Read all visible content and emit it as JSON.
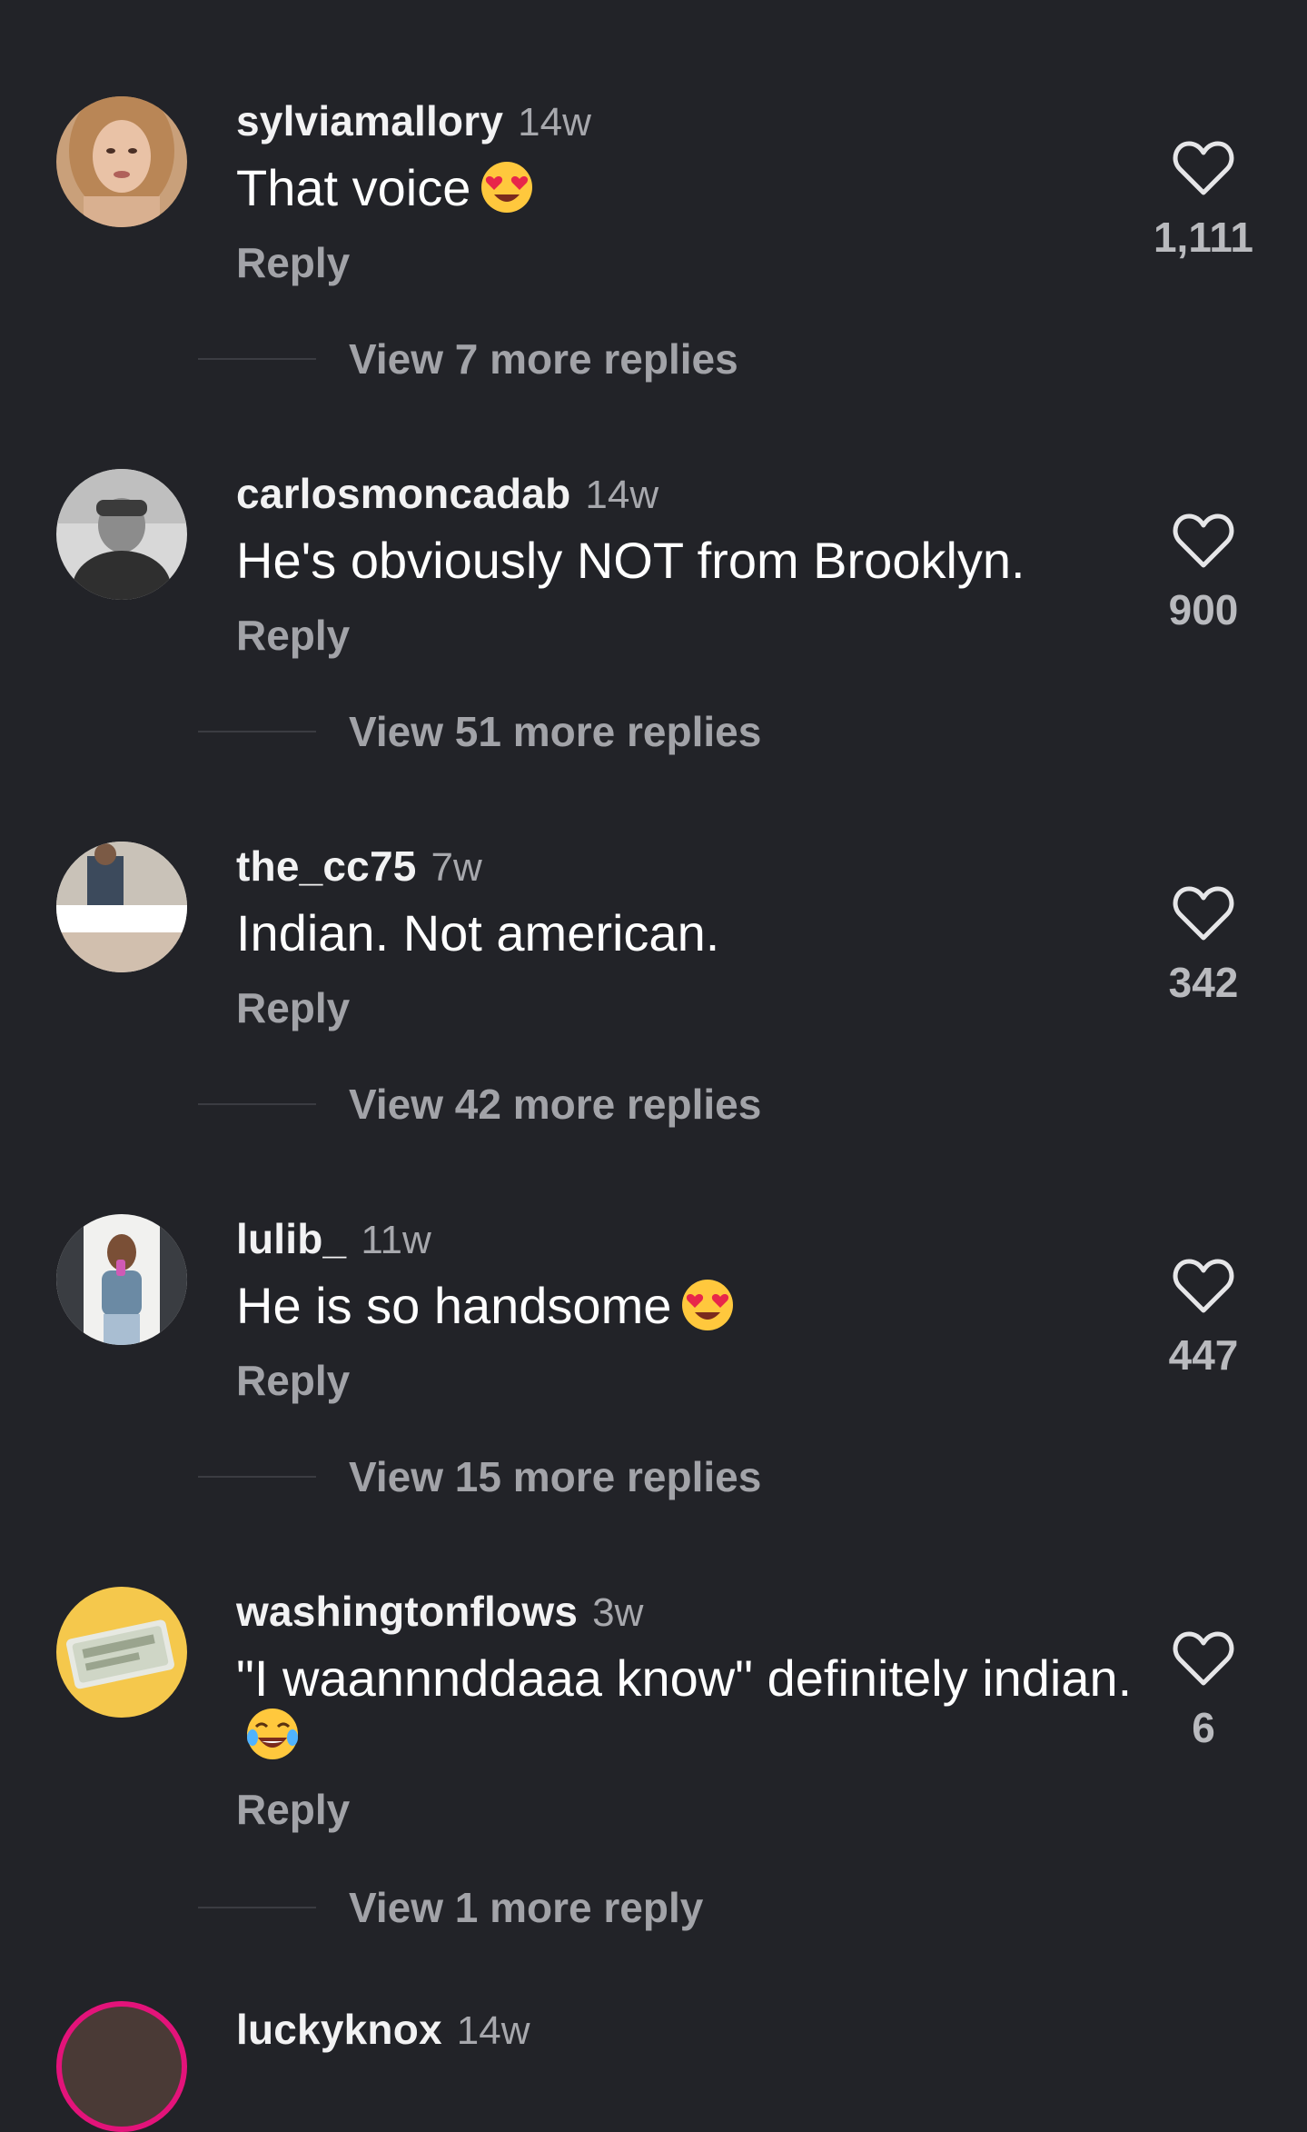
{
  "comments": [
    {
      "username": "sylviamallory",
      "time": "14w",
      "text": "That voice",
      "emoji": "heart-eyes",
      "reply": "Reply",
      "likes": "1,111",
      "view_more": "View 7 more replies"
    },
    {
      "username": "carlosmoncadab",
      "time": "14w",
      "text": "He's obviously NOT from Brooklyn.",
      "emoji": "",
      "reply": "Reply",
      "likes": "900",
      "view_more": "View 51 more replies"
    },
    {
      "username": "the_cc75",
      "time": "7w",
      "text": "Indian. Not american.",
      "emoji": "",
      "reply": "Reply",
      "likes": "342",
      "view_more": "View 42 more replies"
    },
    {
      "username": "lulib_",
      "time": "11w",
      "text": "He is so handsome",
      "emoji": "heart-eyes",
      "reply": "Reply",
      "likes": "447",
      "view_more": "View 15 more replies"
    },
    {
      "username": "washingtonflows",
      "time": "3w",
      "text": "\"I waannnddaaa know\" definitely indian.",
      "emoji": "tears-of-joy",
      "reply": "Reply",
      "likes": "6",
      "view_more": "View 1 more reply"
    }
  ],
  "partial_comment": {
    "username": "luckyknox",
    "time": "14w"
  },
  "colors": {
    "background": "#222328",
    "secondary_text": "#a2a3a8",
    "story_ring": "#e3137a"
  },
  "icons": {
    "like": "heart-outline-icon"
  }
}
